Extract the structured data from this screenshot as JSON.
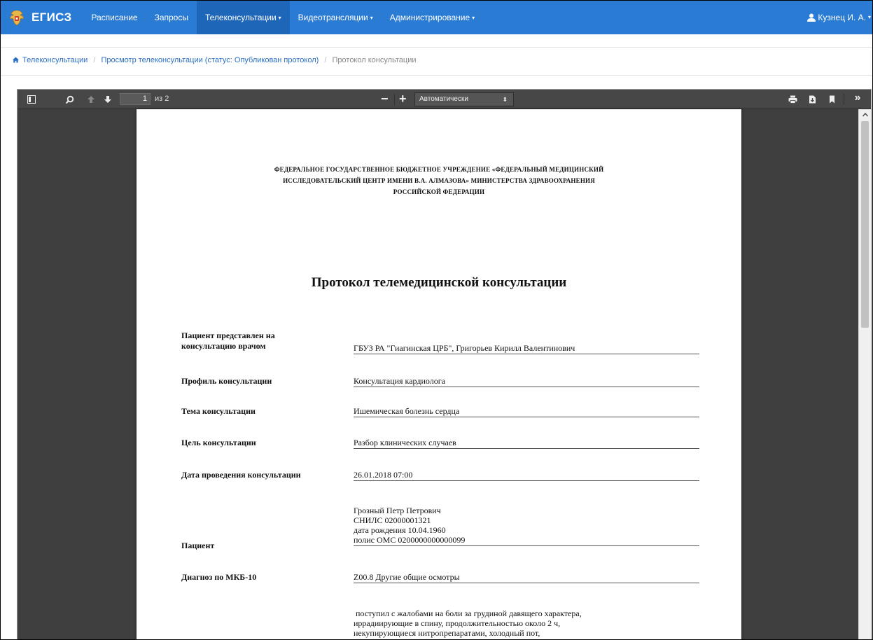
{
  "navbar": {
    "brand": "ЕГИСЗ",
    "items": [
      {
        "label": "Расписание",
        "caret": ""
      },
      {
        "label": "Запросы",
        "caret": ""
      },
      {
        "label": "Телеконсультации",
        "caret": "▾"
      },
      {
        "label": "Видеотрансляции",
        "caret": "▾"
      },
      {
        "label": "Администрирование",
        "caret": "▾"
      }
    ],
    "user": "Кузнец И. А.",
    "user_caret": "▾"
  },
  "breadcrumb": {
    "items": [
      "Телеконсультации",
      "Просмотр телеконсультации (статус: Опубликован протокол)",
      "Протокол консультации"
    ],
    "separator": "/"
  },
  "viewer": {
    "page_number": "1",
    "page_of": "из 2",
    "zoom_minus": "−",
    "zoom_plus": "+",
    "zoom_value": "Автоматически",
    "zoom_arrows": "⬍",
    "tools_more": "»"
  },
  "document": {
    "org_lines": [
      "ФЕДЕРАЛЬНОЕ ГОСУДАРСТВЕННОЕ БЮДЖЕТНОЕ УЧРЕЖДЕНИЕ «ФЕДЕРАЛЬНЫЙ МЕДИЦИНСКИЙ",
      "ИССЛЕДОВАТЕЛЬСКИЙ ЦЕНТР ИМЕНИ В.А. АЛМАЗОВА» МИНИСТЕРСТВА ЗДРАВООХРАНЕНИЯ",
      "РОССИЙСКОЙ ФЕДЕРАЦИИ"
    ],
    "title": "Протокол телемедицинской консультации",
    "fields": [
      {
        "label": [
          "Пациент представлен на",
          "консультацию врачом"
        ],
        "value": [
          "ГБУЗ РА \"Гиагинская ЦРБ\", Григорьев Кирилл Валентинович"
        ]
      },
      {
        "label": [
          "Профиль консультации"
        ],
        "value": [
          "Консультация кардиолога"
        ]
      },
      {
        "label": [
          "Тема консультации"
        ],
        "value": [
          "Ишемическая болезнь сердца"
        ]
      },
      {
        "label": [
          "Цель консультации"
        ],
        "value": [
          "Разбор клинических случаев"
        ]
      },
      {
        "label": [
          "Дата проведения консультации"
        ],
        "value": [
          "26.01.2018 07:00"
        ]
      },
      {
        "label": [
          "Пациент"
        ],
        "value": [
          "Грозный Петр Петрович",
          "СНИЛС 02000001321",
          "дата рождения 10.04.1960",
          "полис ОМС 0200000000000099"
        ]
      },
      {
        "label": [
          "Диагноз по МКБ-10"
        ],
        "value": [
          "Z00.8 Другие общие осмотры"
        ]
      },
      {
        "label": [],
        "value": [
          " поступил с жалобами на боли за грудиной давящего характера,",
          "иррадиирующие в спину, продолжительностью около 2 ч,",
          "некупирующиеся нитропрепаратами, холодный пот,"
        ]
      }
    ]
  }
}
